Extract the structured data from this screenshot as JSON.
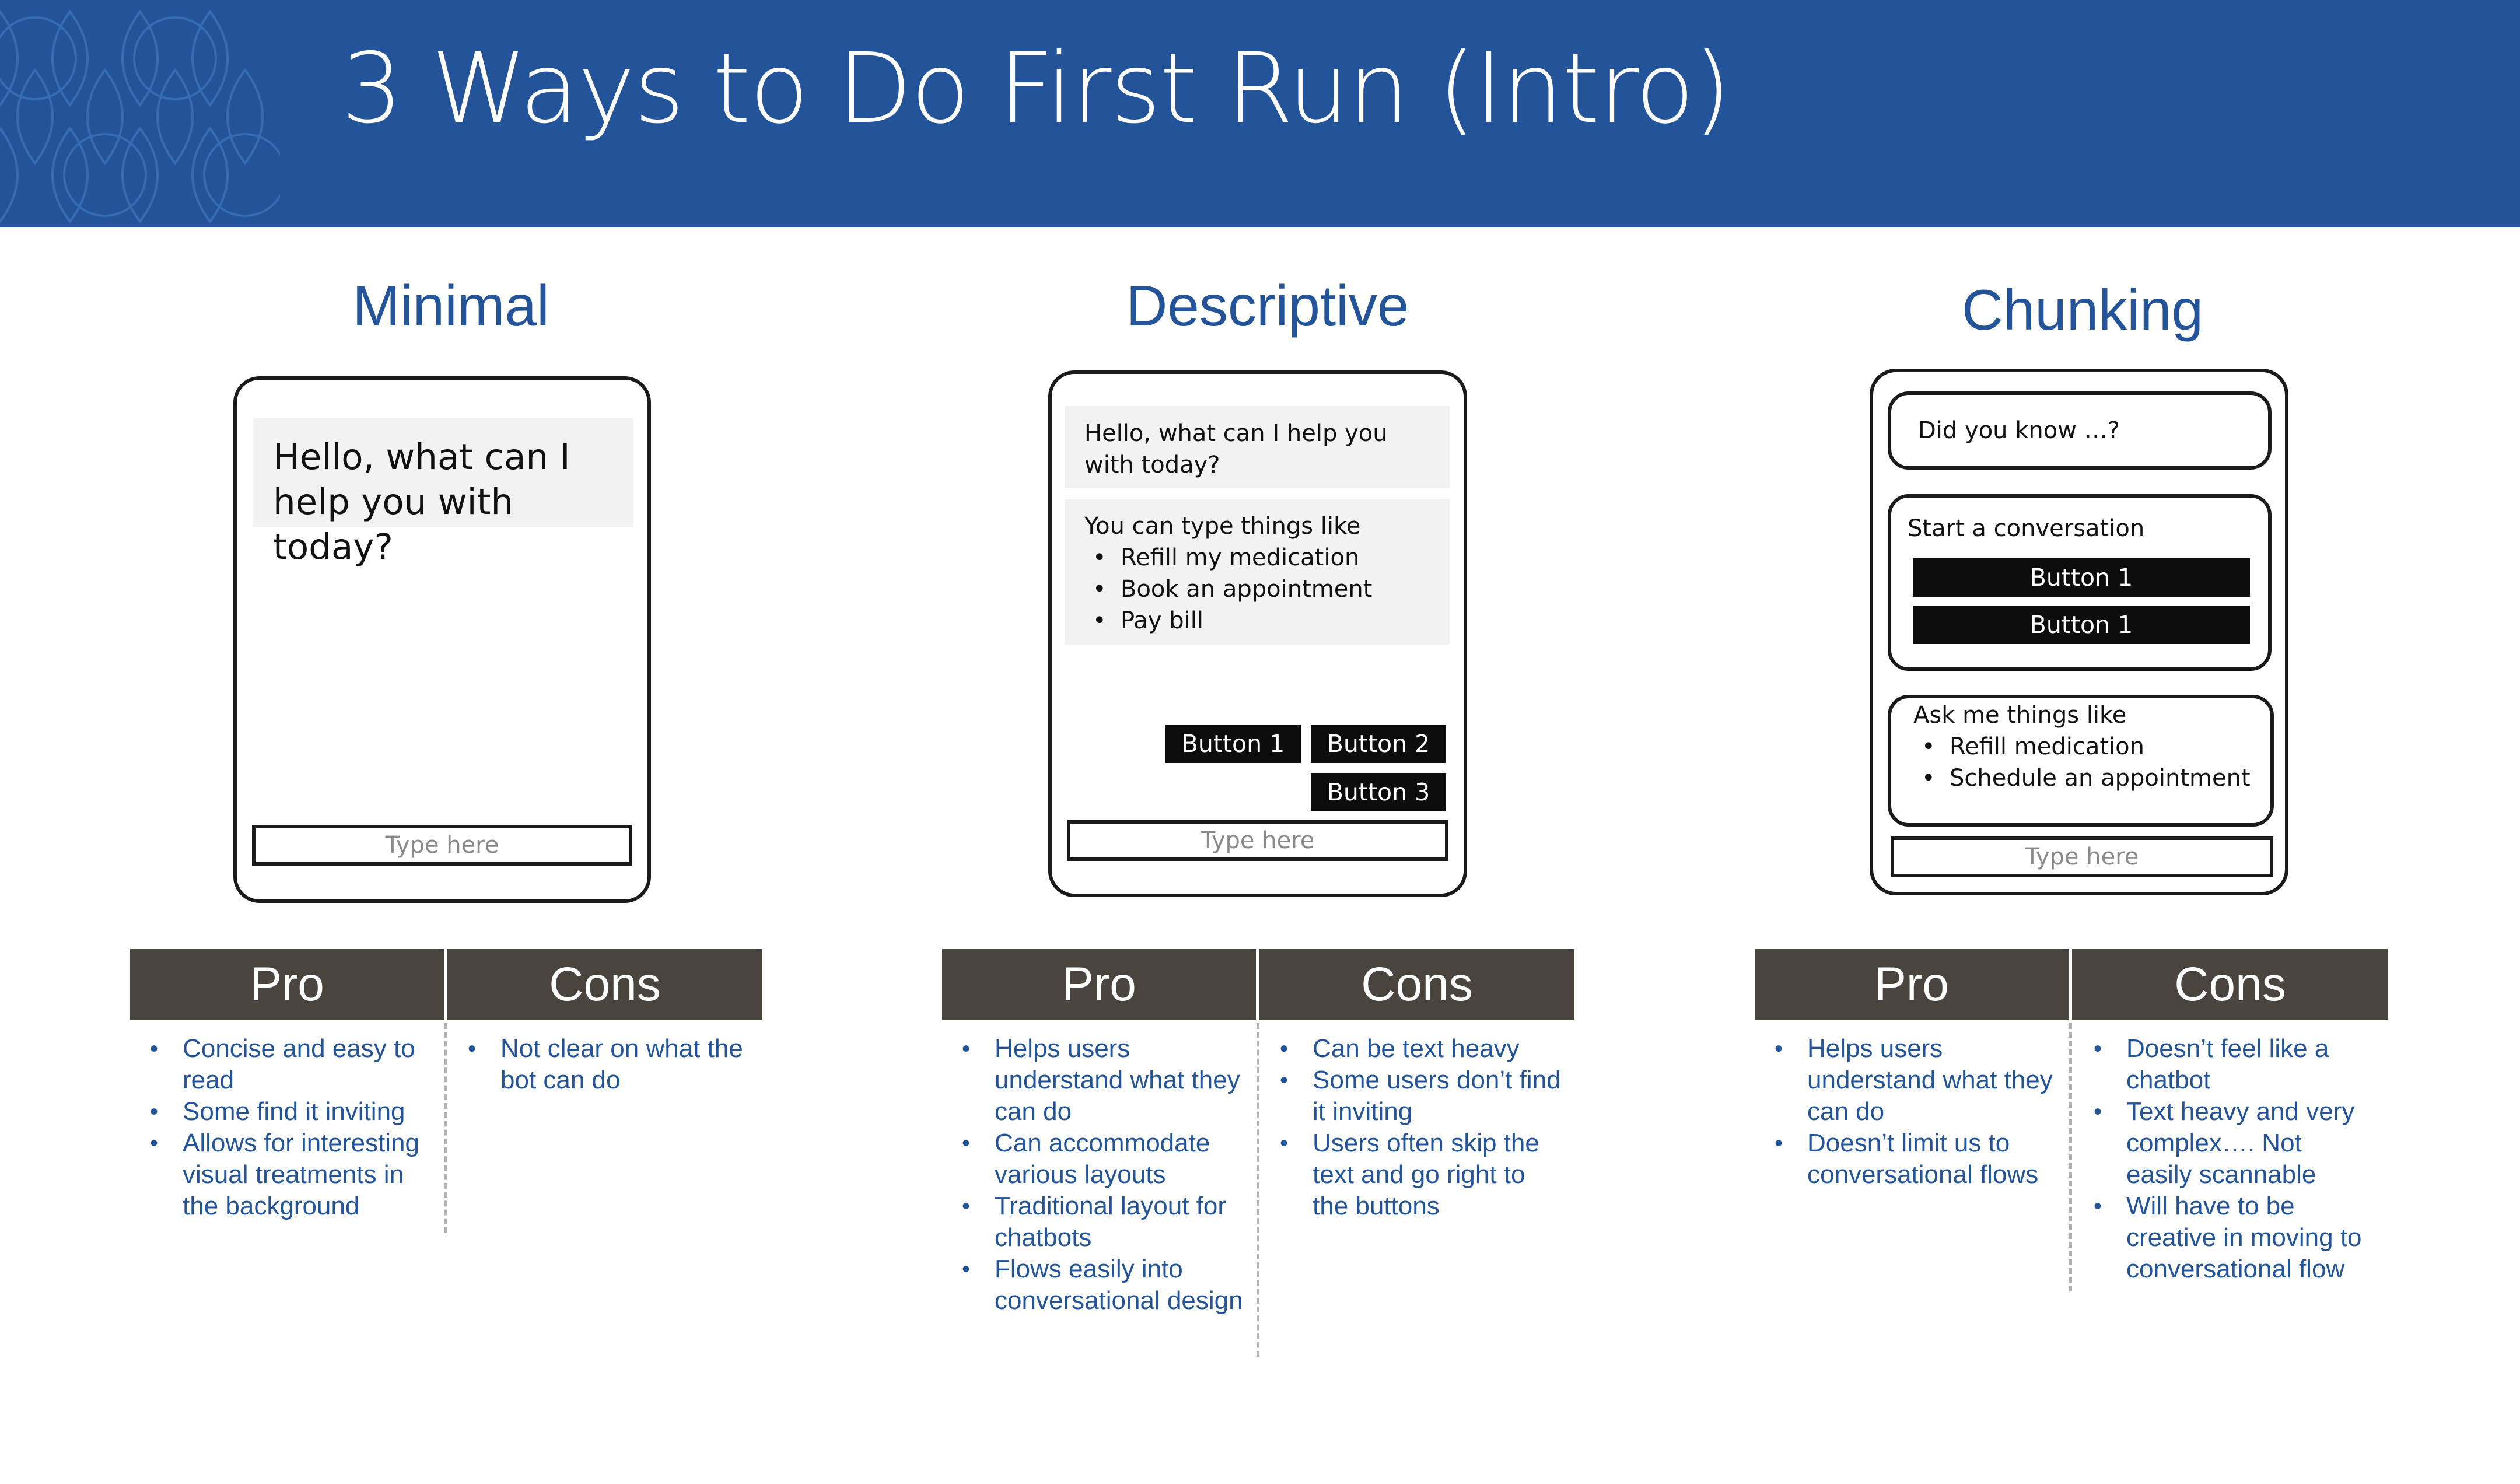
{
  "title": "3 Ways to Do First Run (Intro)",
  "columns": {
    "minimal": {
      "title": "Minimal",
      "greeting": "Hello, what can I help you with today?",
      "input_placeholder": "Type here",
      "pro_label": "Pro",
      "cons_label": "Cons",
      "pros": [
        "Concise and easy to read",
        "Some find it inviting",
        "Allows for interesting visual treatments in the background"
      ],
      "cons": [
        "Not clear on what the bot can do"
      ]
    },
    "descriptive": {
      "title": "Descriptive",
      "greeting": "Hello, what can I help you with today?",
      "hint_intro": "You can type things like",
      "hint_items": [
        "Refill my medication",
        "Book an appointment",
        "Pay bill"
      ],
      "buttons": [
        "Button 1",
        "Button 2",
        "Button 3"
      ],
      "input_placeholder": "Type here",
      "pro_label": "Pro",
      "cons_label": "Cons",
      "pros": [
        "Helps users understand what they can do",
        "Can accommodate various layouts",
        "Traditional layout for chatbots",
        "Flows easily into conversational design"
      ],
      "cons": [
        "Can be text heavy",
        "Some users don’t find it inviting",
        "Users often skip the text and go right to the buttons"
      ]
    },
    "chunking": {
      "title": "Chunking",
      "did_you_know": "Did you know …?",
      "start_label": "Start a conversation",
      "buttons": [
        "Button 1",
        "Button 1"
      ],
      "ask_intro": "Ask me things like",
      "ask_items": [
        "Refill medication",
        "Schedule an appointment"
      ],
      "input_placeholder": "Type here",
      "pro_label": "Pro",
      "cons_label": "Cons",
      "pros": [
        "Helps users understand what they can do",
        "Doesn’t limit us to conversational flows"
      ],
      "cons": [
        "Doesn’t feel like a chatbot",
        "Text heavy and very complex…. Not easily scannable",
        "Will have to be creative in moving to conversational flow"
      ]
    }
  }
}
